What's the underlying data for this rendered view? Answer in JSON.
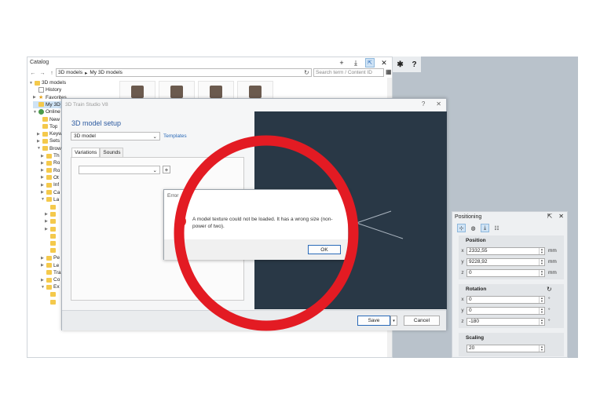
{
  "catalog": {
    "title": "Catalog",
    "breadcrumb": [
      "3D models",
      "My 3D models"
    ],
    "search_placeholder": "Search term / Content ID",
    "tree": [
      {
        "label": "3D models",
        "icon": "folder",
        "level": 0,
        "expand": "v"
      },
      {
        "label": "History",
        "icon": "history",
        "level": 1,
        "expand": ""
      },
      {
        "label": "Favorites",
        "icon": "star",
        "level": 1,
        "expand": ">"
      },
      {
        "label": "My 3D models",
        "icon": "folder",
        "level": 1,
        "expand": "",
        "selected": true
      },
      {
        "label": "Online",
        "icon": "globe",
        "level": 1,
        "expand": "v"
      },
      {
        "label": "New",
        "icon": "folder",
        "level": 2,
        "expand": ""
      },
      {
        "label": "Top",
        "icon": "folder",
        "level": 2,
        "expand": ""
      },
      {
        "label": "Keyw",
        "icon": "folder",
        "level": 2,
        "expand": ">"
      },
      {
        "label": "Sets",
        "icon": "folder",
        "level": 2,
        "expand": ">"
      },
      {
        "label": "Brow",
        "icon": "folder",
        "level": 2,
        "expand": "v"
      },
      {
        "label": "Th",
        "icon": "folder",
        "level": 3,
        "expand": ">"
      },
      {
        "label": "Ro",
        "icon": "folder",
        "level": 3,
        "expand": ">"
      },
      {
        "label": "Ro",
        "icon": "folder",
        "level": 3,
        "expand": ">"
      },
      {
        "label": "Ot",
        "icon": "folder",
        "level": 3,
        "expand": ">"
      },
      {
        "label": "Inf",
        "icon": "folder",
        "level": 3,
        "expand": ">"
      },
      {
        "label": "Ca",
        "icon": "folder",
        "level": 3,
        "expand": ">"
      },
      {
        "label": "La",
        "icon": "folder",
        "level": 3,
        "expand": "v"
      },
      {
        "label": "",
        "icon": "folder",
        "level": 4,
        "expand": ""
      },
      {
        "label": "",
        "icon": "folder",
        "level": 4,
        "expand": ">"
      },
      {
        "label": "",
        "icon": "folder",
        "level": 4,
        "expand": ">"
      },
      {
        "label": "",
        "icon": "folder",
        "level": 4,
        "expand": ">"
      },
      {
        "label": "",
        "icon": "folder",
        "level": 4,
        "expand": ""
      },
      {
        "label": "",
        "icon": "folder",
        "level": 4,
        "expand": ""
      },
      {
        "label": "",
        "icon": "folder",
        "level": 4,
        "expand": ""
      },
      {
        "label": "Pe",
        "icon": "folder",
        "level": 3,
        "expand": ">"
      },
      {
        "label": "Le",
        "icon": "folder",
        "level": 3,
        "expand": ">"
      },
      {
        "label": "Tra",
        "icon": "folder",
        "level": 3,
        "expand": ""
      },
      {
        "label": "Co",
        "icon": "folder",
        "level": 3,
        "expand": ">"
      },
      {
        "label": "Ex",
        "icon": "folder",
        "level": 3,
        "expand": "v"
      },
      {
        "label": "",
        "icon": "folder",
        "level": 4,
        "expand": ""
      },
      {
        "label": "",
        "icon": "folder",
        "level": 4,
        "expand": ""
      }
    ]
  },
  "dialog": {
    "title": "3D Train Studio V8",
    "help": "?",
    "close": "✕",
    "heading": "3D model setup",
    "type_value": "3D model",
    "templates_label": "Templates",
    "tabs": [
      "Variations",
      "Sounds"
    ],
    "add_label": "+",
    "save_label": "Save",
    "cancel_label": "Cancel"
  },
  "error": {
    "title": "Error",
    "message": "A model texture could not be loaded. It has a wrong size (non-power of two).",
    "ok_label": "OK"
  },
  "positioning": {
    "title": "Positioning",
    "position_label": "Position",
    "position": [
      {
        "axis": "x",
        "value": "2332,55",
        "unit": "mm"
      },
      {
        "axis": "y",
        "value": "9228,92",
        "unit": "mm"
      },
      {
        "axis": "z",
        "value": "0",
        "unit": "mm"
      }
    ],
    "rotation_label": "Rotation",
    "rotation": [
      {
        "axis": "x",
        "value": "0",
        "unit": "°"
      },
      {
        "axis": "y",
        "value": "0",
        "unit": "°"
      },
      {
        "axis": "z",
        "value": "-180",
        "unit": "°"
      }
    ],
    "scaling_label": "Scaling",
    "scaling_value": "20"
  },
  "toolbar": {
    "gear": "✱",
    "help": "?"
  },
  "colors": {
    "highlight_ring": "#e31b23",
    "preview_bg": "#293846",
    "accent": "#2a6ab8"
  }
}
